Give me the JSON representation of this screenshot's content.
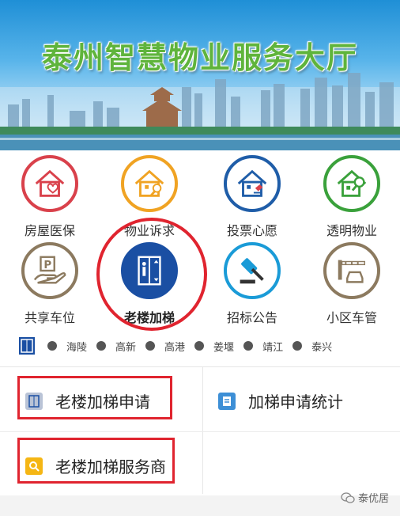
{
  "banner": {
    "title": "泰州智慧物业服务大厅"
  },
  "grid": {
    "row1": [
      {
        "label": "房屋医保",
        "icon": "house-heart-icon",
        "color": "#d9414b"
      },
      {
        "label": "物业诉求",
        "icon": "house-microphone-icon",
        "color": "#f0a323"
      },
      {
        "label": "投票心愿",
        "icon": "house-vote-icon",
        "color": "#1f5da8"
      },
      {
        "label": "透明物业",
        "icon": "house-magnifier-icon",
        "color": "#3aa13b"
      }
    ],
    "row2": [
      {
        "label": "共享车位",
        "icon": "parking-hand-icon",
        "color": "#8c7a5f"
      },
      {
        "label": "老楼加梯",
        "icon": "elevator-icon",
        "color": "#1a4fa3"
      },
      {
        "label": "招标公告",
        "icon": "gavel-icon",
        "color": "#1a9bd7"
      },
      {
        "label": "小区车管",
        "icon": "barrier-car-icon",
        "color": "#8c7a5f"
      }
    ]
  },
  "districts": [
    "海陵",
    "高新",
    "高港",
    "姜堰",
    "靖江",
    "泰兴"
  ],
  "menu": {
    "apply": "老楼加梯申请",
    "stats": "加梯申请统计",
    "providers": "老楼加梯服务商"
  },
  "watermark": "泰优居",
  "colors": {
    "accent_red": "#e0242f",
    "brand_blue": "#1a4fa3",
    "title_green": "#5fb43c"
  }
}
